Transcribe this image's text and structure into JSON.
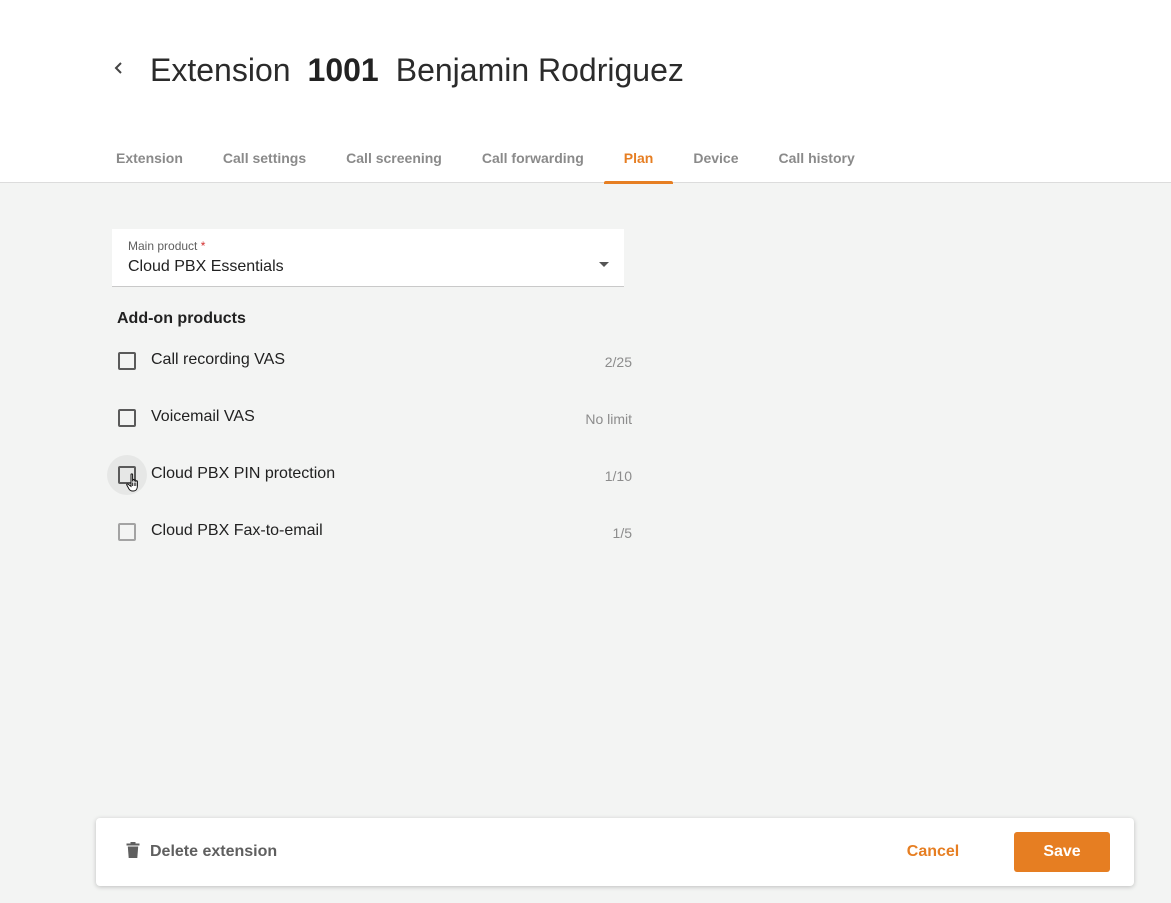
{
  "header": {
    "title_prefix": "Extension",
    "extension_number": "1001",
    "user_name": "Benjamin Rodriguez"
  },
  "tabs": [
    {
      "label": "Extension",
      "active": false
    },
    {
      "label": "Call settings",
      "active": false
    },
    {
      "label": "Call screening",
      "active": false
    },
    {
      "label": "Call forwarding",
      "active": false
    },
    {
      "label": "Plan",
      "active": true
    },
    {
      "label": "Device",
      "active": false
    },
    {
      "label": "Call history",
      "active": false
    }
  ],
  "main_product": {
    "label": "Main product",
    "required_marker": "*",
    "value": "Cloud PBX Essentials"
  },
  "addons": {
    "title": "Add-on products",
    "items": [
      {
        "name": "Call recording VAS",
        "qty": "2/25",
        "checked": false
      },
      {
        "name": "Voicemail VAS",
        "qty": "No limit",
        "checked": false
      },
      {
        "name": "Cloud PBX PIN protection",
        "qty": "1/10",
        "checked": false
      },
      {
        "name": "Cloud PBX Fax-to-email",
        "qty": "1/5",
        "checked": false
      }
    ]
  },
  "footer": {
    "delete_label": "Delete extension",
    "cancel_label": "Cancel",
    "save_label": "Save"
  },
  "colors": {
    "accent": "#e67e22",
    "background": "#f3f4f3"
  }
}
